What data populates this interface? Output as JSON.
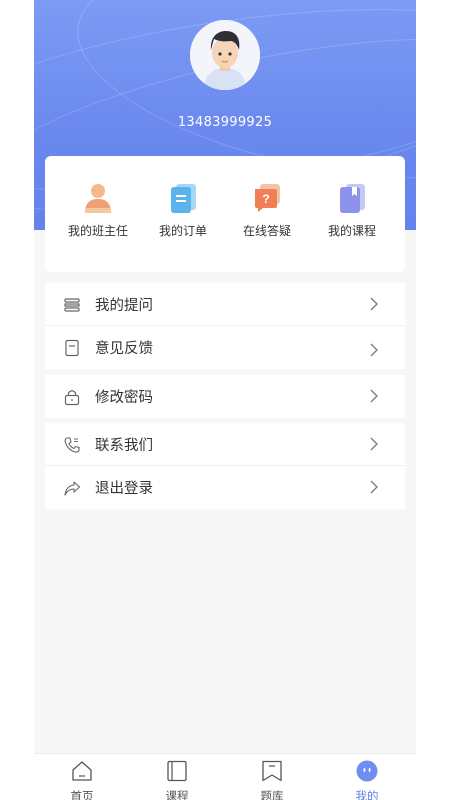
{
  "profile": {
    "phone": "13483999925"
  },
  "quick_actions": [
    {
      "label": "我的班主任",
      "icon": "person-icon"
    },
    {
      "label": "我的订单",
      "icon": "order-doc-icon"
    },
    {
      "label": "在线答疑",
      "icon": "question-chat-icon"
    },
    {
      "label": "我的课程",
      "icon": "course-book-icon"
    }
  ],
  "menu": {
    "questions": "我的提问",
    "feedback": "意见反馈",
    "change_password": "修改密码",
    "contact": "联系我们",
    "logout": "退出登录"
  },
  "tabs": [
    {
      "label": "首页",
      "icon": "home-icon"
    },
    {
      "label": "课程",
      "icon": "course-icon"
    },
    {
      "label": "题库",
      "icon": "bookmark-icon"
    },
    {
      "label": "我的",
      "icon": "profile-face-icon",
      "active": true
    }
  ],
  "colors": {
    "header_gradient": "#7c9bf4",
    "accent": "#5b7fe8",
    "background": "#f7f7f7"
  }
}
